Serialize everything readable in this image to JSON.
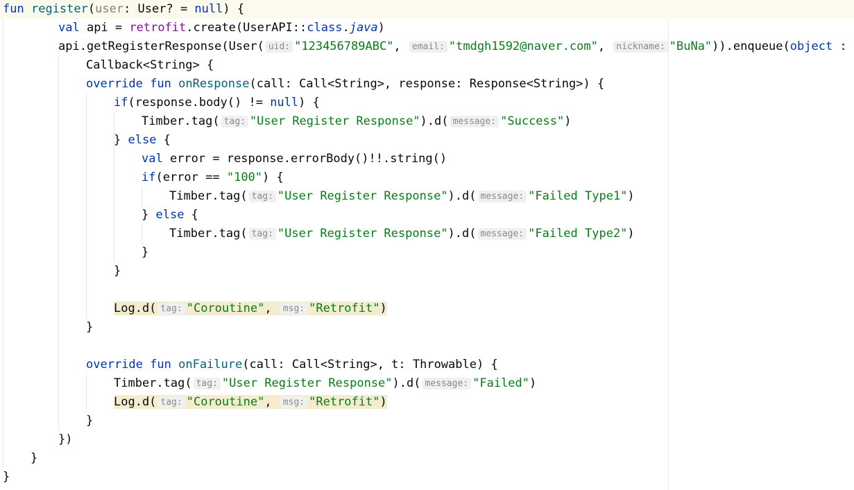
{
  "code": {
    "l1": {
      "kw1": "fun",
      "fn": "register",
      "p1": "(",
      "param": "user",
      "p2": ": User? = ",
      "kw2": "null",
      "p3": ") {"
    },
    "l2": {
      "kw": "val",
      "p1": " api = ",
      "prop": "retrofit",
      "p2": ".create(UserAPI::",
      "kw2": "class",
      "p3": ".",
      "it": "java",
      "p4": ")"
    },
    "l3": {
      "p1": "api.getRegisterResponse(User(",
      "h1": "uid:",
      "s1": "\"123456789ABC\"",
      "p2": ", ",
      "h2": "email:",
      "s2": "\"tmdgh1592@naver.com\"",
      "p3": ", ",
      "h3": "nickname:",
      "s3": "\"BuNa\"",
      "p4": ")).enqueue(",
      "kw": "object",
      "p5": " :"
    },
    "l4": {
      "p1": "Callback<String> {"
    },
    "l5": {
      "kw1": "override",
      "kw2": "fun",
      "fn": "onResponse",
      "p1": "(call: Call<String>, response: Response<String>) {"
    },
    "l6": {
      "kw1": "if",
      "p1": "(response.body() != ",
      "kw2": "null",
      "p2": ") {"
    },
    "l7": {
      "p1": "Timber.tag(",
      "h1": "tag:",
      "s1": "\"User Register Response\"",
      "p2": ").d(",
      "h2": "message:",
      "s2": "\"Success\"",
      "p3": ")"
    },
    "l8": {
      "p1": "} ",
      "kw": "else",
      "p2": " {"
    },
    "l9": {
      "kw": "val",
      "p1": " error = response.errorBody()!!.string()"
    },
    "l10": {
      "kw": "if",
      "p1": "(error == ",
      "s1": "\"100\"",
      "p2": ") {"
    },
    "l11": {
      "p1": "Timber.tag(",
      "h1": "tag:",
      "s1": "\"User Register Response\"",
      "p2": ").d(",
      "h2": "message:",
      "s2": "\"Failed Type1\"",
      "p3": ")"
    },
    "l12": {
      "p1": "} ",
      "kw": "else",
      "p2": " {"
    },
    "l13": {
      "p1": "Timber.tag(",
      "h1": "tag:",
      "s1": "\"User Register Response\"",
      "p2": ").d(",
      "h2": "message:",
      "s2": "\"Failed Type2\"",
      "p3": ")"
    },
    "l14": {
      "p1": "}"
    },
    "l15": {
      "p1": "}"
    },
    "l17": {
      "p1": "Log.d(",
      "h1": "tag:",
      "s1": "\"Coroutine\"",
      "p2": ", ",
      "h2": "msg:",
      "s2": "\"Retrofit\"",
      "p3": ")"
    },
    "l18": {
      "p1": "}"
    },
    "l20": {
      "kw1": "override",
      "kw2": "fun",
      "fn": "onFailure",
      "p1": "(call: Call<String>, t: Throwable) {"
    },
    "l21": {
      "p1": "Timber.tag(",
      "h1": "tag:",
      "s1": "\"User Register Response\"",
      "p2": ").d(",
      "h2": "message:",
      "s2": "\"Failed\"",
      "p3": ")"
    },
    "l22": {
      "p1": "Log.d(",
      "h1": "tag:",
      "s1": "\"Coroutine\"",
      "p2": ", ",
      "h2": "msg:",
      "s2": "\"Retrofit\"",
      "p3": ")"
    },
    "l23": {
      "p1": "}"
    },
    "l24": {
      "p1": "})"
    },
    "l25": {
      "p1": "}"
    },
    "l26": {
      "p1": "}"
    }
  },
  "colors": {
    "keyword": "#0033b3",
    "function": "#00627a",
    "string": "#067d17",
    "property": "#871094",
    "hint_bg": "#f0f0f0",
    "highlight": "#f4eccf",
    "caret_line": "#fcfaed"
  }
}
